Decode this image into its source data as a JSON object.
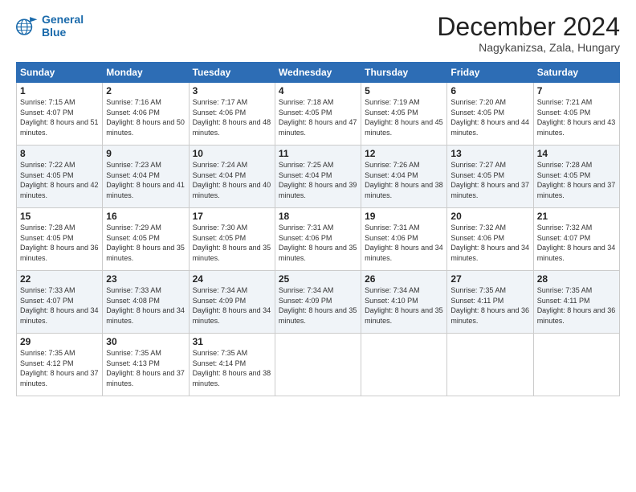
{
  "logo": {
    "line1": "General",
    "line2": "Blue"
  },
  "title": "December 2024",
  "subtitle": "Nagykanizsa, Zala, Hungary",
  "days_header": [
    "Sunday",
    "Monday",
    "Tuesday",
    "Wednesday",
    "Thursday",
    "Friday",
    "Saturday"
  ],
  "weeks": [
    [
      {
        "day": "1",
        "rise": "7:15 AM",
        "set": "4:07 PM",
        "daylight": "8 hours and 51 minutes."
      },
      {
        "day": "2",
        "rise": "7:16 AM",
        "set": "4:06 PM",
        "daylight": "8 hours and 50 minutes."
      },
      {
        "day": "3",
        "rise": "7:17 AM",
        "set": "4:06 PM",
        "daylight": "8 hours and 48 minutes."
      },
      {
        "day": "4",
        "rise": "7:18 AM",
        "set": "4:05 PM",
        "daylight": "8 hours and 47 minutes."
      },
      {
        "day": "5",
        "rise": "7:19 AM",
        "set": "4:05 PM",
        "daylight": "8 hours and 45 minutes."
      },
      {
        "day": "6",
        "rise": "7:20 AM",
        "set": "4:05 PM",
        "daylight": "8 hours and 44 minutes."
      },
      {
        "day": "7",
        "rise": "7:21 AM",
        "set": "4:05 PM",
        "daylight": "8 hours and 43 minutes."
      }
    ],
    [
      {
        "day": "8",
        "rise": "7:22 AM",
        "set": "4:05 PM",
        "daylight": "8 hours and 42 minutes."
      },
      {
        "day": "9",
        "rise": "7:23 AM",
        "set": "4:04 PM",
        "daylight": "8 hours and 41 minutes."
      },
      {
        "day": "10",
        "rise": "7:24 AM",
        "set": "4:04 PM",
        "daylight": "8 hours and 40 minutes."
      },
      {
        "day": "11",
        "rise": "7:25 AM",
        "set": "4:04 PM",
        "daylight": "8 hours and 39 minutes."
      },
      {
        "day": "12",
        "rise": "7:26 AM",
        "set": "4:04 PM",
        "daylight": "8 hours and 38 minutes."
      },
      {
        "day": "13",
        "rise": "7:27 AM",
        "set": "4:05 PM",
        "daylight": "8 hours and 37 minutes."
      },
      {
        "day": "14",
        "rise": "7:28 AM",
        "set": "4:05 PM",
        "daylight": "8 hours and 37 minutes."
      }
    ],
    [
      {
        "day": "15",
        "rise": "7:28 AM",
        "set": "4:05 PM",
        "daylight": "8 hours and 36 minutes."
      },
      {
        "day": "16",
        "rise": "7:29 AM",
        "set": "4:05 PM",
        "daylight": "8 hours and 35 minutes."
      },
      {
        "day": "17",
        "rise": "7:30 AM",
        "set": "4:05 PM",
        "daylight": "8 hours and 35 minutes."
      },
      {
        "day": "18",
        "rise": "7:31 AM",
        "set": "4:06 PM",
        "daylight": "8 hours and 35 minutes."
      },
      {
        "day": "19",
        "rise": "7:31 AM",
        "set": "4:06 PM",
        "daylight": "8 hours and 34 minutes."
      },
      {
        "day": "20",
        "rise": "7:32 AM",
        "set": "4:06 PM",
        "daylight": "8 hours and 34 minutes."
      },
      {
        "day": "21",
        "rise": "7:32 AM",
        "set": "4:07 PM",
        "daylight": "8 hours and 34 minutes."
      }
    ],
    [
      {
        "day": "22",
        "rise": "7:33 AM",
        "set": "4:07 PM",
        "daylight": "8 hours and 34 minutes."
      },
      {
        "day": "23",
        "rise": "7:33 AM",
        "set": "4:08 PM",
        "daylight": "8 hours and 34 minutes."
      },
      {
        "day": "24",
        "rise": "7:34 AM",
        "set": "4:09 PM",
        "daylight": "8 hours and 34 minutes."
      },
      {
        "day": "25",
        "rise": "7:34 AM",
        "set": "4:09 PM",
        "daylight": "8 hours and 35 minutes."
      },
      {
        "day": "26",
        "rise": "7:34 AM",
        "set": "4:10 PM",
        "daylight": "8 hours and 35 minutes."
      },
      {
        "day": "27",
        "rise": "7:35 AM",
        "set": "4:11 PM",
        "daylight": "8 hours and 36 minutes."
      },
      {
        "day": "28",
        "rise": "7:35 AM",
        "set": "4:11 PM",
        "daylight": "8 hours and 36 minutes."
      }
    ],
    [
      {
        "day": "29",
        "rise": "7:35 AM",
        "set": "4:12 PM",
        "daylight": "8 hours and 37 minutes."
      },
      {
        "day": "30",
        "rise": "7:35 AM",
        "set": "4:13 PM",
        "daylight": "8 hours and 37 minutes."
      },
      {
        "day": "31",
        "rise": "7:35 AM",
        "set": "4:14 PM",
        "daylight": "8 hours and 38 minutes."
      },
      null,
      null,
      null,
      null
    ]
  ]
}
